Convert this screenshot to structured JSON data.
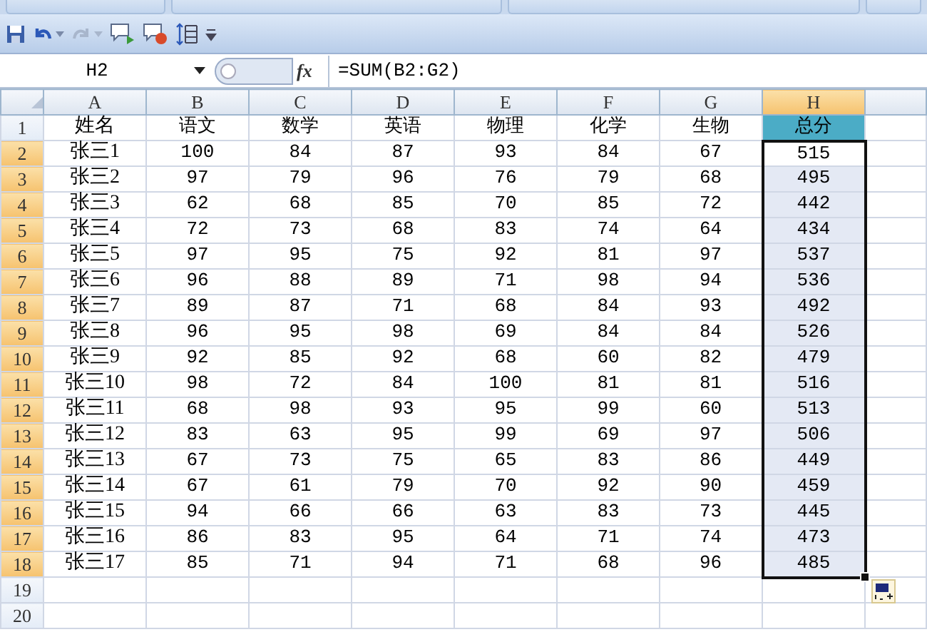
{
  "formula_bar": {
    "name_box": "H2",
    "fx_label": "fx",
    "formula": "=SUM(B2:G2)"
  },
  "columns": [
    {
      "label": "A",
      "selected": false
    },
    {
      "label": "B",
      "selected": false
    },
    {
      "label": "C",
      "selected": false
    },
    {
      "label": "D",
      "selected": false
    },
    {
      "label": "E",
      "selected": false
    },
    {
      "label": "F",
      "selected": false
    },
    {
      "label": "G",
      "selected": false
    },
    {
      "label": "H",
      "selected": true,
      "color": "#4bacc6"
    }
  ],
  "rows": [
    {
      "header": "1",
      "selected": false,
      "cells": [
        "姓名",
        "语文",
        "数学",
        "英语",
        "物理",
        "化学",
        "生物",
        "总分"
      ]
    },
    {
      "header": "2",
      "selected": true,
      "cells": [
        "张三1",
        "100",
        "84",
        "87",
        "93",
        "84",
        "67",
        "515"
      ]
    },
    {
      "header": "3",
      "selected": true,
      "cells": [
        "张三2",
        "97",
        "79",
        "96",
        "76",
        "79",
        "68",
        "495"
      ]
    },
    {
      "header": "4",
      "selected": true,
      "cells": [
        "张三3",
        "62",
        "68",
        "85",
        "70",
        "85",
        "72",
        "442"
      ]
    },
    {
      "header": "5",
      "selected": true,
      "cells": [
        "张三4",
        "72",
        "73",
        "68",
        "83",
        "74",
        "64",
        "434"
      ]
    },
    {
      "header": "6",
      "selected": true,
      "cells": [
        "张三5",
        "97",
        "95",
        "75",
        "92",
        "81",
        "97",
        "537"
      ]
    },
    {
      "header": "7",
      "selected": true,
      "cells": [
        "张三6",
        "96",
        "88",
        "89",
        "71",
        "98",
        "94",
        "536"
      ]
    },
    {
      "header": "8",
      "selected": true,
      "cells": [
        "张三7",
        "89",
        "87",
        "71",
        "68",
        "84",
        "93",
        "492"
      ]
    },
    {
      "header": "9",
      "selected": true,
      "cells": [
        "张三8",
        "96",
        "95",
        "98",
        "69",
        "84",
        "84",
        "526"
      ]
    },
    {
      "header": "10",
      "selected": true,
      "cells": [
        "张三9",
        "92",
        "85",
        "92",
        "68",
        "60",
        "82",
        "479"
      ]
    },
    {
      "header": "11",
      "selected": true,
      "cells": [
        "张三10",
        "98",
        "72",
        "84",
        "100",
        "81",
        "81",
        "516"
      ]
    },
    {
      "header": "12",
      "selected": true,
      "cells": [
        "张三11",
        "68",
        "98",
        "93",
        "95",
        "99",
        "60",
        "513"
      ]
    },
    {
      "header": "13",
      "selected": true,
      "cells": [
        "张三12",
        "83",
        "63",
        "95",
        "99",
        "69",
        "97",
        "506"
      ]
    },
    {
      "header": "14",
      "selected": true,
      "cells": [
        "张三13",
        "67",
        "73",
        "75",
        "65",
        "83",
        "86",
        "449"
      ]
    },
    {
      "header": "15",
      "selected": true,
      "cells": [
        "张三14",
        "67",
        "61",
        "79",
        "70",
        "92",
        "90",
        "459"
      ]
    },
    {
      "header": "16",
      "selected": true,
      "cells": [
        "张三15",
        "94",
        "66",
        "66",
        "63",
        "83",
        "73",
        "445"
      ]
    },
    {
      "header": "17",
      "selected": true,
      "cells": [
        "张三16",
        "86",
        "83",
        "95",
        "64",
        "71",
        "74",
        "473"
      ]
    },
    {
      "header": "18",
      "selected": true,
      "cells": [
        "张三17",
        "85",
        "71",
        "94",
        "71",
        "68",
        "96",
        "485"
      ]
    },
    {
      "header": "19",
      "selected": false,
      "cells": []
    },
    {
      "header": "20",
      "selected": false,
      "cells": []
    }
  ]
}
